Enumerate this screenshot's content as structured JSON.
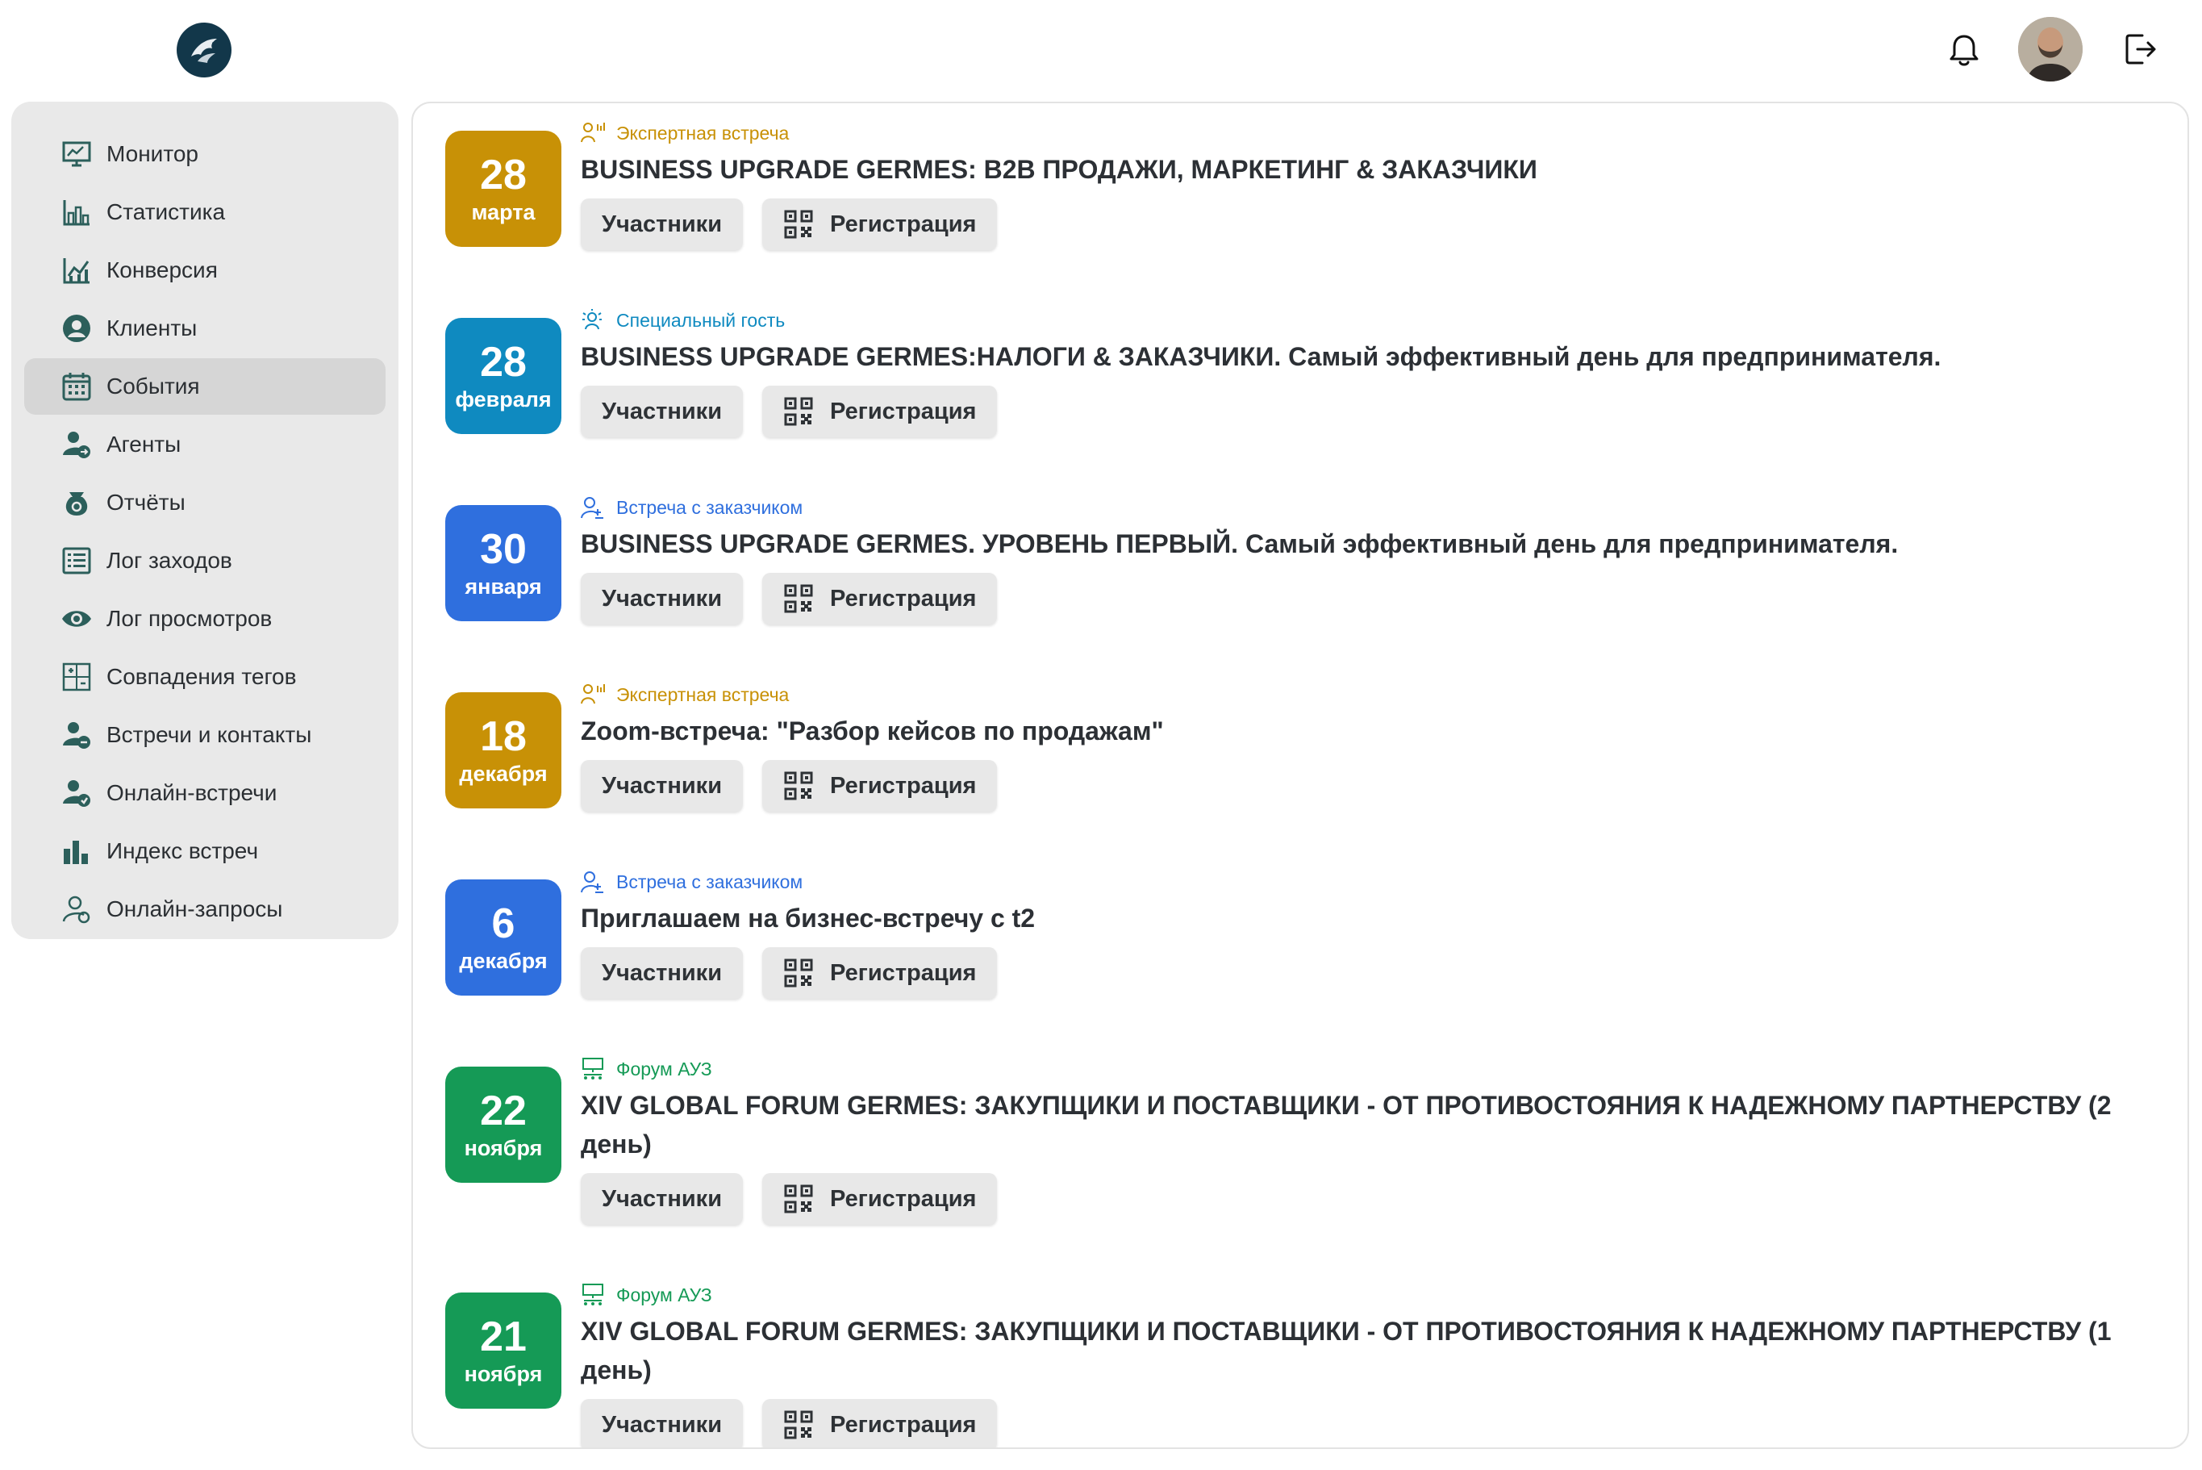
{
  "header": {
    "logo_icon": "germes-logo-icon",
    "notifications_icon": "bell-icon",
    "avatar_alt": "user-avatar",
    "logout_icon": "logout-icon"
  },
  "colors": {
    "expert": "#c89106",
    "guest": "#0f8ac0",
    "client": "#2f6fde",
    "forum": "#159a56",
    "sidebar_icon": "#2c5f5b"
  },
  "sidebar": {
    "items": [
      {
        "label": "Монитор",
        "icon": "monitor-icon",
        "active": false
      },
      {
        "label": "Статистика",
        "icon": "statistics-icon",
        "active": false
      },
      {
        "label": "Конверсия",
        "icon": "conversion-icon",
        "active": false
      },
      {
        "label": "Клиенты",
        "icon": "clients-icon",
        "active": false
      },
      {
        "label": "События",
        "icon": "calendar-icon",
        "active": true
      },
      {
        "label": "Агенты",
        "icon": "agents-icon",
        "active": false
      },
      {
        "label": "Отчёты",
        "icon": "reports-icon",
        "active": false
      },
      {
        "label": "Лог заходов",
        "icon": "list-icon",
        "active": false
      },
      {
        "label": "Лог просмотров",
        "icon": "eye-icon",
        "active": false
      },
      {
        "label": "Совпадения тегов",
        "icon": "tags-match-icon",
        "active": false
      },
      {
        "label": "Встречи и контакты",
        "icon": "meetings-icon",
        "active": false
      },
      {
        "label": "Онлайн-встречи",
        "icon": "online-meetings-icon",
        "active": false
      },
      {
        "label": "Индекс встреч",
        "icon": "bar-chart-icon",
        "active": false
      },
      {
        "label": "Онлайн-запросы",
        "icon": "online-requests-icon",
        "active": false
      }
    ]
  },
  "buttons": {
    "participants": "Участники",
    "registration": "Регистрация"
  },
  "events": [
    {
      "day": "28",
      "month": "марта",
      "type": "Экспертная встреча",
      "kind": "expert",
      "type_icon": "expert-icon",
      "title": "BUSINESS UPGRADE GERMES: B2B ПРОДАЖИ, МАРКЕТИНГ & ЗАКАЗЧИКИ"
    },
    {
      "day": "28",
      "month": "февраля",
      "type": "Специальный гость",
      "kind": "guest",
      "type_icon": "special-guest-icon",
      "title": "BUSINESS UPGRADE GERMES:НАЛОГИ & ЗАКАЗЧИКИ. Самый эффективный день для предпринимателя."
    },
    {
      "day": "30",
      "month": "января",
      "type": "Встреча с заказчиком",
      "kind": "client",
      "type_icon": "client-meeting-icon",
      "title": "BUSINESS UPGRADE GERMES. УРОВЕНЬ ПЕРВЫЙ. Самый эффективный день для предпринимателя."
    },
    {
      "day": "18",
      "month": "декабря",
      "type": "Экспертная встреча",
      "kind": "expert",
      "type_icon": "expert-icon",
      "title": "Zoom-встреча: \"Разбор кейсов по продажам\""
    },
    {
      "day": "6",
      "month": "декабря",
      "type": "Встреча с заказчиком",
      "kind": "client",
      "type_icon": "client-meeting-icon",
      "title": "Приглашаем на бизнес-встречу с t2"
    },
    {
      "day": "22",
      "month": "ноября",
      "type": "Форум АУЗ",
      "kind": "forum",
      "type_icon": "forum-icon",
      "title": "XIV GLOBAL FORUM GERMES: ЗАКУПЩИКИ И ПОСТАВЩИКИ - ОТ ПРОТИВОСТОЯНИЯ К НАДЕЖНОМУ ПАРТНЕРСТВУ (2 день)"
    },
    {
      "day": "21",
      "month": "ноября",
      "type": "Форум АУЗ",
      "kind": "forum",
      "type_icon": "forum-icon",
      "title": "XIV GLOBAL FORUM GERMES: ЗАКУПЩИКИ И ПОСТАВЩИКИ - ОТ ПРОТИВОСТОЯНИЯ К НАДЕЖНОМУ ПАРТНЕРСТВУ (1 день)"
    }
  ]
}
